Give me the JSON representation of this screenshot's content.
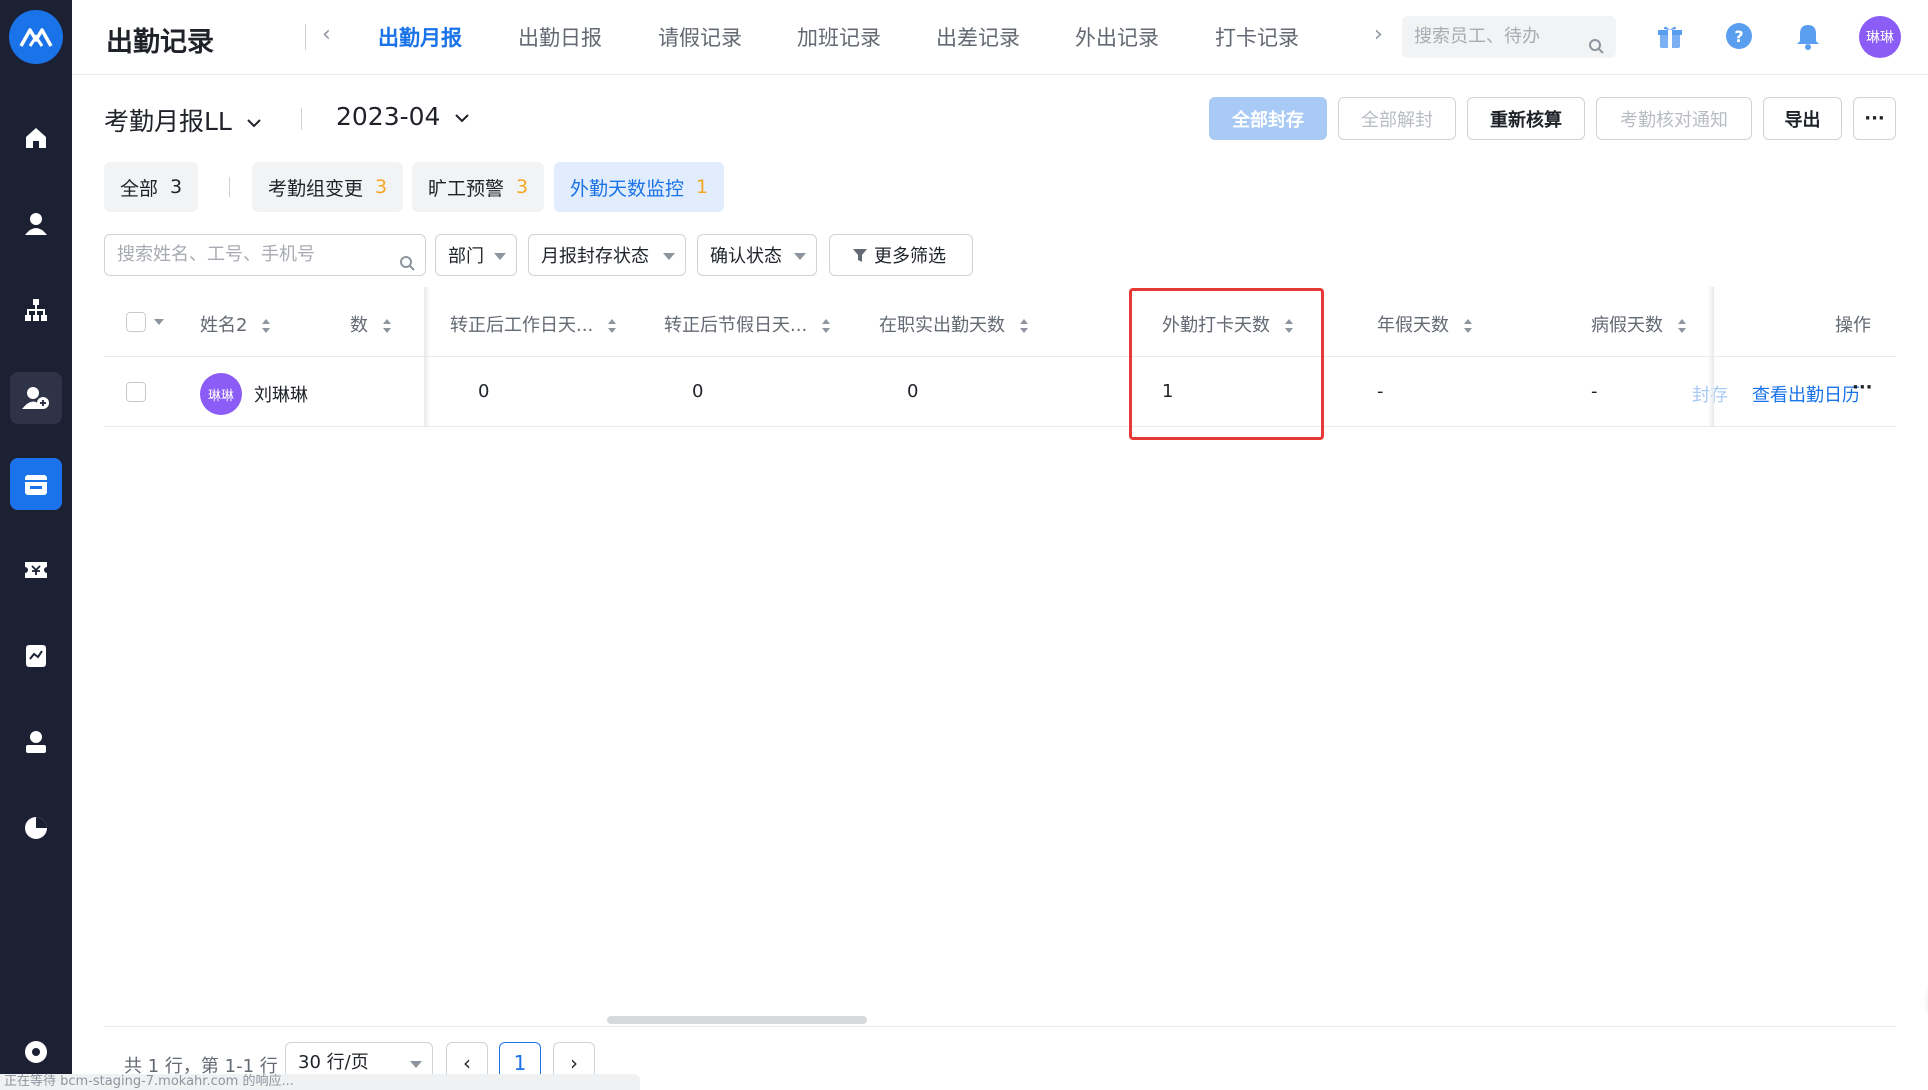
{
  "app": {
    "title": "出勤记录"
  },
  "sidebar": {
    "items": [
      {
        "icon": "home-icon"
      },
      {
        "icon": "user-icon"
      },
      {
        "icon": "org-chart-icon"
      },
      {
        "icon": "user-add-icon"
      },
      {
        "icon": "calendar-icon",
        "active": true
      },
      {
        "icon": "ticket-icon"
      },
      {
        "icon": "chart-icon"
      },
      {
        "icon": "user-card-icon"
      },
      {
        "icon": "pie-chart-icon"
      },
      {
        "icon": "settings-icon"
      }
    ]
  },
  "tabs": [
    "出勤月报",
    "出勤日报",
    "请假记录",
    "加班记录",
    "出差记录",
    "外出记录",
    "打卡记录"
  ],
  "top_search": {
    "placeholder": "搜索员工、待办"
  },
  "user": {
    "avatar_text": "琳琳"
  },
  "report": {
    "title": "考勤月报LL",
    "month": "2023-04"
  },
  "actions": {
    "seal_all": "全部封存",
    "unseal_all": "全部解封",
    "recalculate": "重新核算",
    "notify": "考勤核对通知",
    "export": "导出",
    "more": "···"
  },
  "chips": [
    {
      "label": "全部",
      "count": "3"
    },
    {
      "label": "考勤组变更",
      "count": "3"
    },
    {
      "label": "旷工预警",
      "count": "3"
    },
    {
      "label": "外勤天数监控",
      "count": "1"
    }
  ],
  "filters": {
    "search_placeholder": "搜索姓名、工号、手机号",
    "department": "部门",
    "seal_status": "月报封存状态",
    "confirm_status": "确认状态",
    "more": "更多筛选"
  },
  "table": {
    "headers": {
      "name": "姓名2",
      "truncated": "数",
      "work_days_after": "转正后工作日天...",
      "holiday_days_after": "转正后节假日天...",
      "actual_days": "在职实出勤天数",
      "field_days": "外勤打卡天数",
      "annual_leave": "年假天数",
      "sick_leave": "病假天数",
      "ops": "操作"
    },
    "rows": [
      {
        "avatar": "琳琳",
        "name": "刘琳琳",
        "work_days_after": "0",
        "holiday_days_after": "0",
        "actual_days": "0",
        "field_days": "1",
        "annual_leave": "-",
        "sick_leave": "-",
        "seal": "封存",
        "view_calendar": "查看出勤日历",
        "more": "···"
      }
    ]
  },
  "pagination": {
    "summary": "共 1 行，第 1-1 行",
    "page_size": "30 行/页",
    "current": "1",
    "prev": "‹",
    "next": "›"
  },
  "status_bar": "正在等待 bcm-staging-7.mokahr.com 的响应...",
  "colors": {
    "accent": "#1a73e8",
    "sidebar": "#1c2033",
    "highlight": "#e53935",
    "warn": "#f5a623"
  }
}
